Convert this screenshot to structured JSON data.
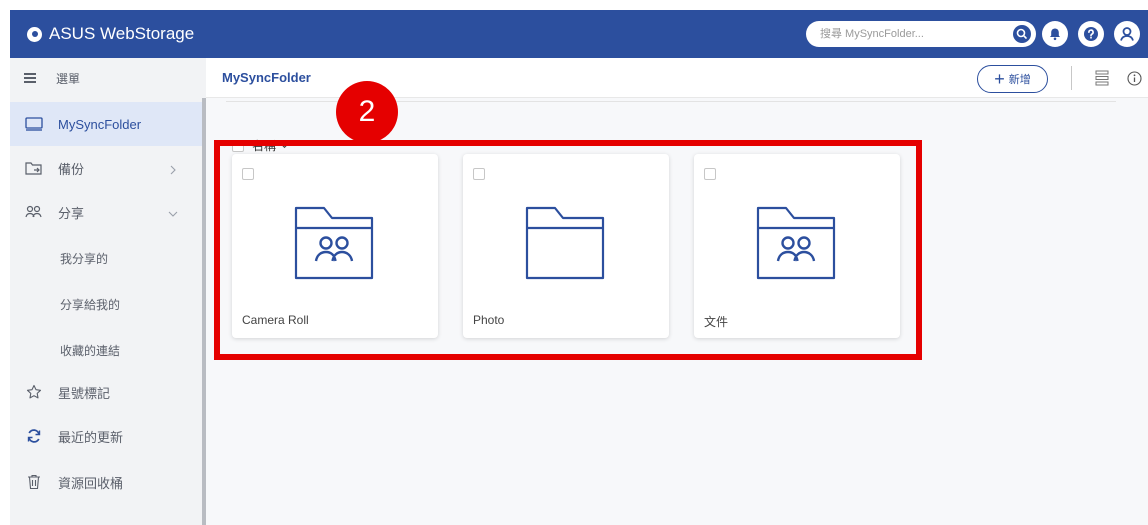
{
  "header": {
    "app_name": "ASUS WebStorage",
    "search_placeholder": "搜尋 MySyncFolder...",
    "icons": [
      "search-icon",
      "bell-icon",
      "help-icon",
      "user-icon"
    ],
    "brand_color": "#2c4f9e"
  },
  "sidebar": {
    "menu_label": "選單",
    "items": [
      {
        "label": "MySyncFolder",
        "icon": "device-icon",
        "active": true
      },
      {
        "label": "備份",
        "icon": "backup-icon"
      },
      {
        "label": "分享",
        "icon": "share-icon"
      },
      {
        "label": "我分享的"
      },
      {
        "label": "分享給我的"
      },
      {
        "label": "收藏的連結"
      },
      {
        "label": "星號標記",
        "icon": "star-icon"
      },
      {
        "label": "最近的更新",
        "icon": "refresh-icon"
      },
      {
        "label": "資源回收桶",
        "icon": "trash-icon"
      }
    ]
  },
  "main": {
    "folder_title": "MySyncFolder",
    "new_button_label": "新增",
    "sort_label": "名稱",
    "folders": [
      {
        "name": "Camera Roll",
        "icon": "shared-folder-icon"
      },
      {
        "name": "Photo",
        "icon": "folder-icon"
      },
      {
        "name": "文件",
        "icon": "shared-folder-icon"
      }
    ]
  },
  "annotation": {
    "step_number": "2",
    "highlight_color": "#e50000"
  }
}
